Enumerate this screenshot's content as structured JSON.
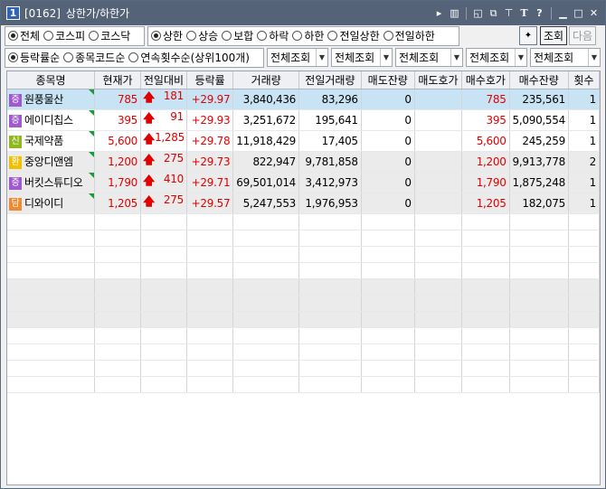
{
  "window": {
    "number": "1",
    "code": "[0162]",
    "title": "상한가/하한가"
  },
  "filter_row1": {
    "market": [
      {
        "label": "전체",
        "selected": true
      },
      {
        "label": "코스피",
        "selected": false
      },
      {
        "label": "코스닥",
        "selected": false
      }
    ],
    "condition": [
      {
        "label": "상한",
        "selected": true
      },
      {
        "label": "상승",
        "selected": false
      },
      {
        "label": "보합",
        "selected": false
      },
      {
        "label": "하락",
        "selected": false
      },
      {
        "label": "하한",
        "selected": false
      },
      {
        "label": "전일상한",
        "selected": false
      },
      {
        "label": "전일하한",
        "selected": false
      }
    ],
    "query_button": "조회",
    "next_button": "다음"
  },
  "filter_row2": {
    "sort": [
      {
        "label": "등락률순",
        "selected": true
      },
      {
        "label": "종목코드순",
        "selected": false
      },
      {
        "label": "연속횟수순(상위100개)",
        "selected": false
      }
    ],
    "selects": [
      "전체조회",
      "전체조회",
      "전체조회",
      "전체조회",
      "전체조회"
    ]
  },
  "table": {
    "headers": [
      "종목명",
      "현재가",
      "전일대비",
      "등락률",
      "거래량",
      "전일거래량",
      "매도잔량",
      "매도호가",
      "매수호가",
      "매수잔량",
      "횟수"
    ],
    "rows": [
      {
        "badge": "증",
        "badge_color": "#a05ad0",
        "name": "원풍물산",
        "price": "785",
        "change": "181",
        "rate": "+29.97",
        "volume": "3,840,436",
        "prev_volume": "83,296",
        "ask_qty": "0",
        "ask_price": "",
        "bid_price": "785",
        "bid_qty": "235,561",
        "count": "1"
      },
      {
        "badge": "증",
        "badge_color": "#a05ad0",
        "name": "에이디칩스",
        "price": "395",
        "change": "91",
        "rate": "+29.93",
        "volume": "3,251,672",
        "prev_volume": "195,641",
        "ask_qty": "0",
        "ask_price": "",
        "bid_price": "395",
        "bid_qty": "5,090,554",
        "count": "1"
      },
      {
        "badge": "신",
        "badge_color": "#8fb820",
        "name": "국제약품",
        "price": "5,600",
        "change": "1,285",
        "rate": "+29.78",
        "volume": "11,918,429",
        "prev_volume": "17,405",
        "ask_qty": "0",
        "ask_price": "",
        "bid_price": "5,600",
        "bid_qty": "245,259",
        "count": "1"
      },
      {
        "badge": "환",
        "badge_color": "#f0c000",
        "name": "중앙디앤엠",
        "price": "1,200",
        "change": "275",
        "rate": "+29.73",
        "volume": "822,947",
        "prev_volume": "9,781,858",
        "ask_qty": "0",
        "ask_price": "",
        "bid_price": "1,200",
        "bid_qty": "9,913,778",
        "count": "2"
      },
      {
        "badge": "증",
        "badge_color": "#a05ad0",
        "name": "버킷스튜디오",
        "price": "1,790",
        "change": "410",
        "rate": "+29.71",
        "volume": "69,501,014",
        "prev_volume": "3,412,973",
        "ask_qty": "0",
        "ask_price": "",
        "bid_price": "1,790",
        "bid_qty": "1,875,248",
        "count": "1"
      },
      {
        "badge": "담",
        "badge_color": "#f08a30",
        "name": "디와이디",
        "price": "1,205",
        "change": "275",
        "rate": "+29.57",
        "volume": "5,247,553",
        "prev_volume": "1,976,953",
        "ask_qty": "0",
        "ask_price": "",
        "bid_price": "1,205",
        "bid_qty": "182,075",
        "count": "1"
      }
    ]
  },
  "colors": {
    "titlebar": "#546378",
    "up": "#e00000",
    "selected_row": "#c8e4f4",
    "grey_row": "#ebebeb"
  }
}
